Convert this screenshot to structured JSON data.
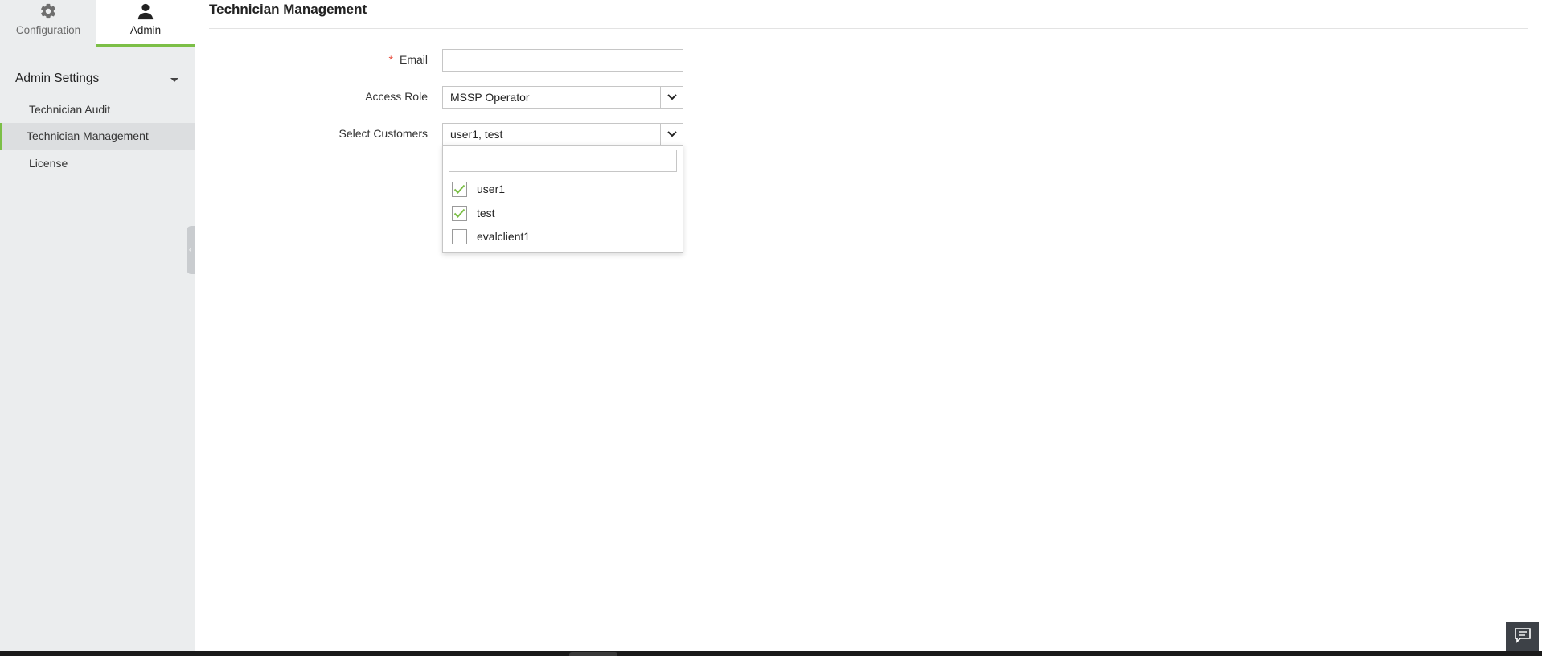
{
  "sidebar": {
    "tabs": [
      {
        "label": "Configuration",
        "icon": "gear-icon"
      },
      {
        "label": "Admin",
        "icon": "user-icon"
      }
    ],
    "section_title": "Admin Settings",
    "items": [
      {
        "label": "Technician Audit"
      },
      {
        "label": "Technician Management"
      },
      {
        "label": "License"
      }
    ]
  },
  "main": {
    "title": "Technician Management",
    "form": {
      "email": {
        "label": "Email",
        "required_mark": "*",
        "value": "",
        "placeholder": ""
      },
      "access_role": {
        "label": "Access Role",
        "value": "MSSP Operator"
      },
      "select_customers": {
        "label": "Select Customers",
        "value": "user1, test",
        "search_placeholder": "",
        "options": [
          {
            "label": "user1",
            "checked": true
          },
          {
            "label": "test",
            "checked": true
          },
          {
            "label": "evalclient1",
            "checked": false
          }
        ]
      }
    }
  },
  "colors": {
    "accent": "#7cbf47",
    "required": "#e74c3c",
    "sidebar_bg": "#ebedee"
  }
}
